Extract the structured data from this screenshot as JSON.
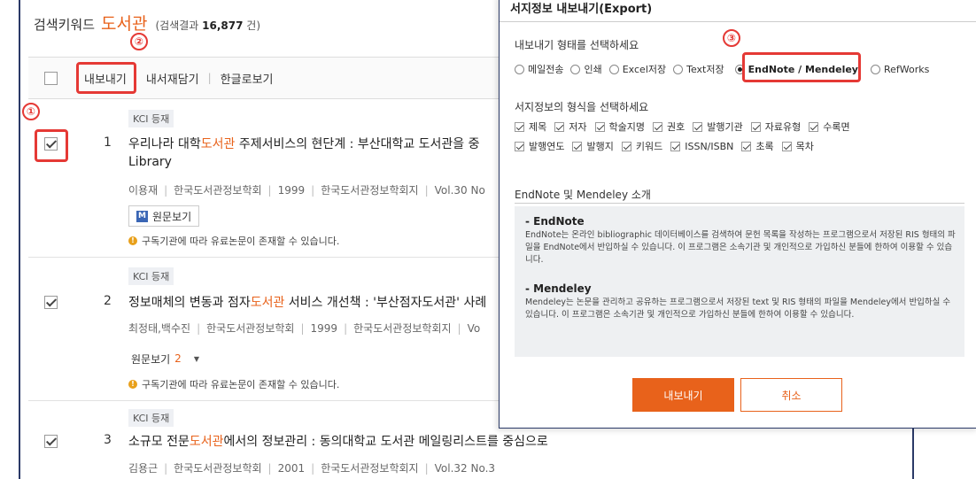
{
  "search": {
    "keyword_label": "검색키워드",
    "keyword": "도서관",
    "result_prefix": "(검색결과",
    "result_count": "16,877",
    "result_suffix": "건)"
  },
  "toolbar": {
    "export_label": "내보내기",
    "save_label": "내서재담기",
    "sep": "|",
    "hangul_label": "한글로보기"
  },
  "results": [
    {
      "badge": "KCI 등재",
      "number": "1",
      "title_pre": "우리나라 대학",
      "title_hl": "도서관",
      "title_post": " 주제서비스의 현단계 : 부산대학교 도서관을 중",
      "title_line2": "Library",
      "author": "이용재",
      "publisher": "한국도서관정보학회",
      "year": "1999",
      "journal": "한국도서관정보학회지",
      "volume": "Vol.30 No",
      "orig_label": "원문보기",
      "orig_icon": "M",
      "notice": "구독기관에 따라 유료논문이 존재할 수 있습니다."
    },
    {
      "badge": "KCI 등재",
      "number": "2",
      "title_pre": "정보매체의 변동과 점자",
      "title_hl": "도서관",
      "title_post": " 서비스 개선책 : '부산점자도서관' 사례",
      "author": "최정태,백수진",
      "publisher": "한국도서관정보학회",
      "year": "1999",
      "journal": "한국도서관정보학회지",
      "volume": "Vo",
      "orig_label": "원문보기",
      "orig_count": "2",
      "caret": "▼",
      "notice": "구독기관에 따라 유료논문이 존재할 수 있습니다."
    },
    {
      "badge": "KCI 등재",
      "number": "3",
      "title_pre": "소규모 전문",
      "title_hl": "도서관",
      "title_post": "에서의 정보관리 : 동의대학교 도서관 메일링리스트를 중심으로",
      "author": "김용근",
      "publisher": "한국도서관정보학회",
      "year": "2001",
      "journal": "한국도서관정보학회지",
      "volume": "Vol.32 No.3"
    }
  ],
  "annotations": [
    "①",
    "②",
    "③"
  ],
  "modal": {
    "title": "서지정보 내보내기(Export)",
    "format_prompt": "내보내기 형태를 선택하세요",
    "formats": [
      "메일전송",
      "인쇄",
      "Excel저장",
      "Text저장",
      "EndNote / Mendeley",
      "RefWorks"
    ],
    "selected_format": "EndNote / Mendeley",
    "fields_prompt": "서지정보의 형식을 선택하세요",
    "fields_row1": [
      "제목",
      "저자",
      "학술지명",
      "권호",
      "발행기관",
      "자료유형",
      "수록면"
    ],
    "fields_row2": [
      "발행연도",
      "발행지",
      "키워드",
      "ISSN/ISBN",
      "초록",
      "목차"
    ],
    "intro_title": "EndNote 및 Mendeley 소개",
    "endnote_heading": "- EndNote",
    "endnote_text": "EndNote는 온라인 bibliographic 데이터베이스를 검색하여 문헌 목록을 작성하는 프로그램으로서 저장된 RIS 형태의 파일을 EndNote에서 반입하실 수 있습니다. 이 프로그램은 소속기관 및 개인적으로 가입하신 분들에 한하여 이용할 수 있습니다.",
    "mendeley_heading": "- Mendeley",
    "mendeley_text": "Mendeley는 논문을 관리하고 공유하는 프로그램으로서 저장된 text 및 RIS 형태의 파일을 Mendeley에서 반입하실 수 있습니다. 이 프로그램은 소속기관 및 개인적으로 가입하신 분들에 한하여 이용할 수 있습니다.",
    "export_button": "내보내기",
    "cancel_button": "취소"
  },
  "colors": {
    "accent": "#e8621b",
    "annotation": "#e53935",
    "frame": "#2b3a67"
  }
}
